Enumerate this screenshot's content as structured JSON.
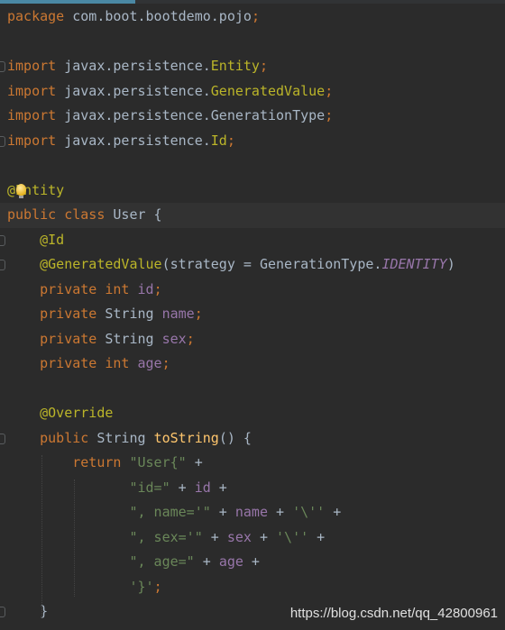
{
  "colors": {
    "background": "#2b2b2b",
    "keyword": "#cc7832",
    "annotation": "#bbb529",
    "string": "#6a8759",
    "field": "#9876aa",
    "method": "#ffc66d",
    "plain": "#a9b7c6"
  },
  "code": {
    "l01": [
      "package",
      " com.boot.bootdemo.pojo",
      ";"
    ],
    "l03": [
      "import",
      " javax.persistence.",
      "Entity",
      ";"
    ],
    "l04": [
      "import",
      " javax.persistence.",
      "GeneratedValue",
      ";"
    ],
    "l05": [
      "import",
      " javax.persistence.",
      "GenerationType",
      ";"
    ],
    "l06": [
      "import",
      " javax.persistence.",
      "Id",
      ";"
    ],
    "l08": [
      "@Entity"
    ],
    "l09": [
      "public class",
      " User {"
    ],
    "l10": [
      "@Id"
    ],
    "l11": [
      "@GeneratedValue",
      "(strategy = GenerationType.",
      "IDENTITY",
      ")"
    ],
    "l12": [
      "private int",
      " id",
      ";"
    ],
    "l13": [
      "private",
      " String ",
      "name",
      ";"
    ],
    "l14": [
      "private",
      " String ",
      "sex",
      ";"
    ],
    "l15": [
      "private int",
      " age",
      ";"
    ],
    "l17": [
      "@Override"
    ],
    "l18": [
      "public",
      " String ",
      "toString",
      "() {"
    ],
    "l19": [
      "return",
      " \"User{\"",
      " +"
    ],
    "l20": [
      "\"id=\"",
      " + ",
      "id",
      " +"
    ],
    "l21": [
      "\", name='\"",
      " + ",
      "name",
      " + ",
      "'\\''",
      " +"
    ],
    "l22": [
      "\", sex='\"",
      " + ",
      "sex",
      " + ",
      "'\\''",
      " +"
    ],
    "l23": [
      "\", age=\"",
      " + ",
      "age",
      " +"
    ],
    "l24": [
      "'}'",
      ";"
    ],
    "l25": [
      "}"
    ]
  },
  "watermark": "https://blog.csdn.net/qq_42800961",
  "icons": {
    "intention": "lightbulb-icon",
    "fold": "fold-marker-icon"
  }
}
